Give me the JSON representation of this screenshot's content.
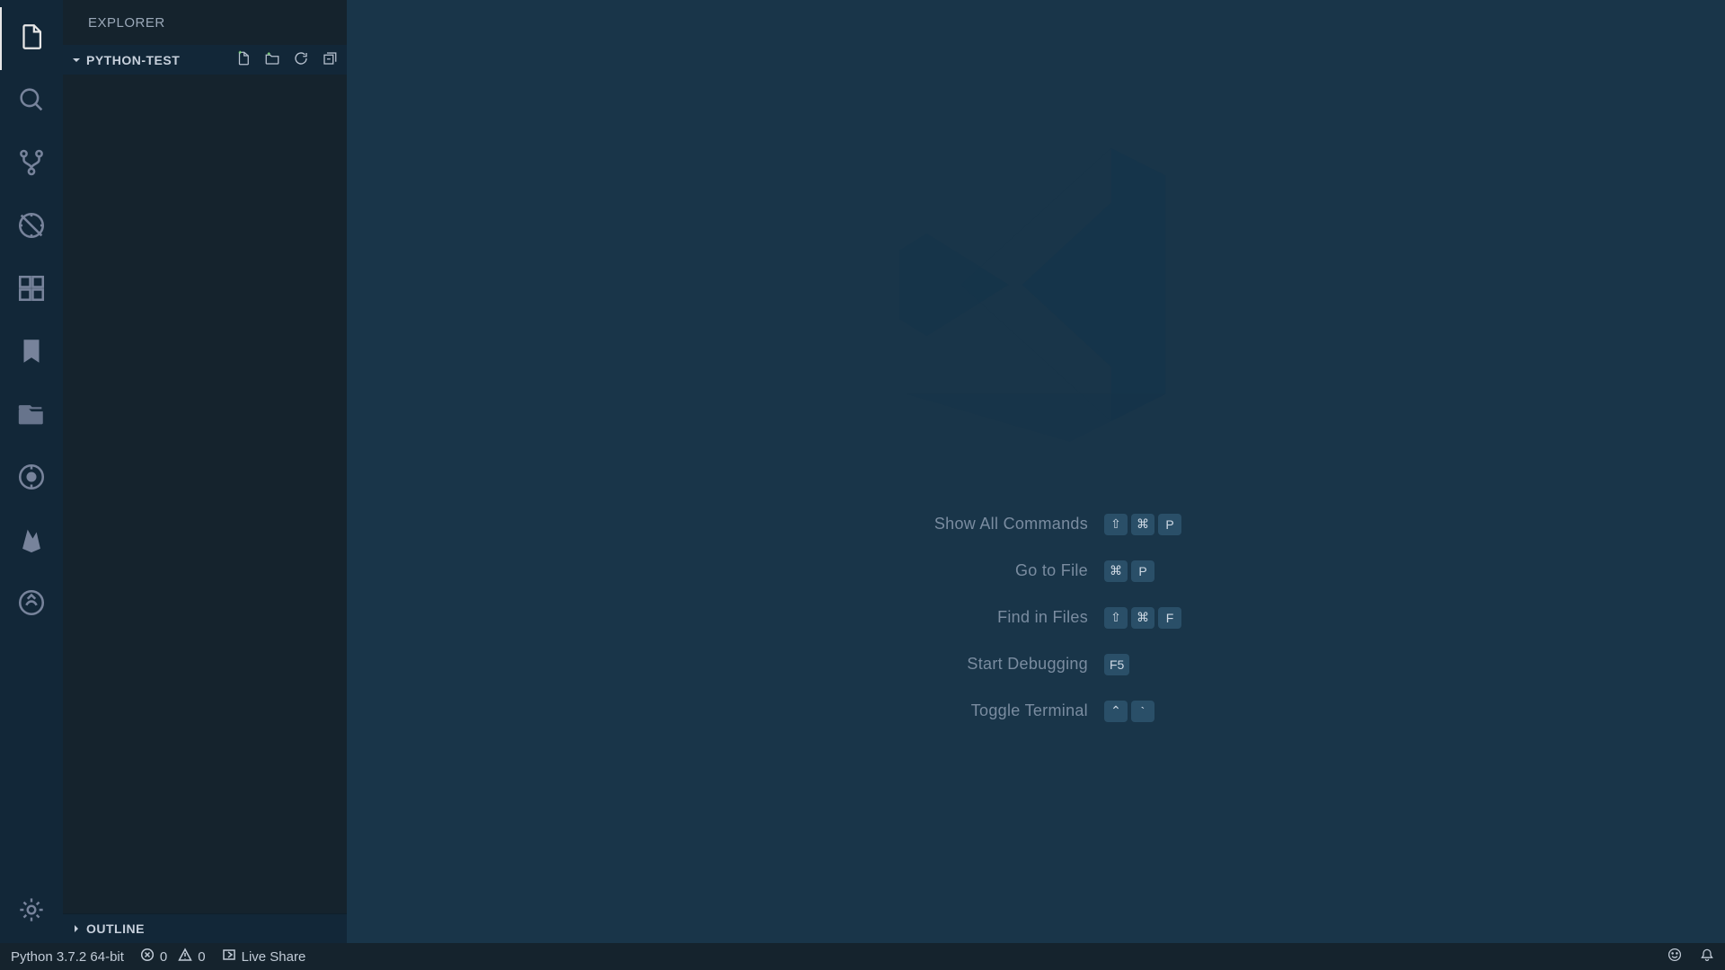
{
  "sidebar": {
    "title": "EXPLORER",
    "folder": "PYTHON-TEST",
    "outline": "OUTLINE"
  },
  "welcome": {
    "commands": [
      {
        "label": "Show All Commands",
        "keys": [
          "⇧",
          "⌘",
          "P"
        ]
      },
      {
        "label": "Go to File",
        "keys": [
          "⌘",
          "P"
        ]
      },
      {
        "label": "Find in Files",
        "keys": [
          "⇧",
          "⌘",
          "F"
        ]
      },
      {
        "label": "Start Debugging",
        "keys": [
          "F5"
        ]
      },
      {
        "label": "Toggle Terminal",
        "keys": [
          "⌃",
          "`"
        ]
      }
    ]
  },
  "statusbar": {
    "interpreter": "Python 3.7.2 64-bit",
    "errors": "0",
    "warnings": "0",
    "liveshare": "Live Share"
  },
  "activity": {
    "icons": [
      "files-icon",
      "search-icon",
      "git-branch-icon",
      "debug-icon",
      "extensions-icon",
      "bookmark-icon",
      "project-icon",
      "gitlens-icon",
      "firebase-icon",
      "share-icon"
    ]
  }
}
